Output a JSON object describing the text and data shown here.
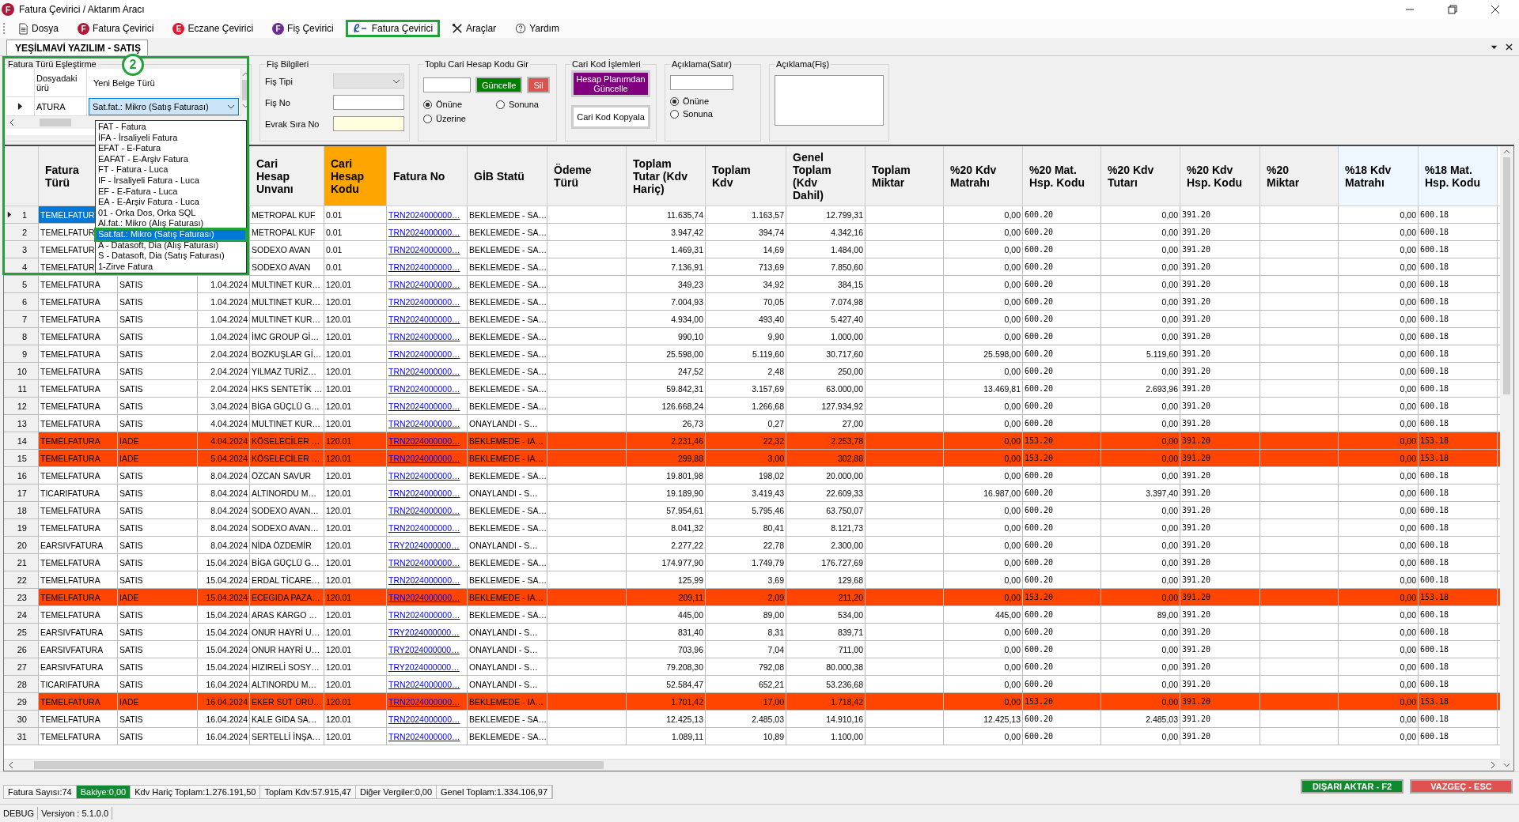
{
  "window": {
    "title": "Fatura Çevirici / Aktarım Aracı",
    "badge": "F",
    "color": "#b0193a"
  },
  "menu": [
    {
      "label": "Dosya",
      "outlined": false
    },
    {
      "label": "Fatura Çevirici",
      "outlined": false,
      "badge": "F",
      "color": "#b0193a"
    },
    {
      "label": "Eczane Çevirici",
      "outlined": false,
      "badge": "E",
      "color": "#e3182d"
    },
    {
      "label": "Fiş Çevirici",
      "outlined": false,
      "badge": "F",
      "color": "#6a2c91"
    },
    {
      "label": "Fatura Çevirici",
      "outlined": true
    },
    {
      "label": "Araçlar",
      "outlined": false
    },
    {
      "label": "Yardım",
      "outlined": false
    }
  ],
  "tabs": [
    {
      "label": "YEŞİLMAVİ YAZILIM - SATIŞ",
      "selected": true
    }
  ],
  "mapping": {
    "title": "Fatura Türü Eşleştirme",
    "callout": "2",
    "columns": [
      "Dosyadaki ürü",
      "Yeni Belge Türü"
    ],
    "row": {
      "source": "ATURA",
      "value": "Sat.fat.: Mikro (Satış Faturası)"
    },
    "options": [
      {
        "label": "FAT - Fatura",
        "selected": false
      },
      {
        "label": "İFA - İrsaliyeli Fatura",
        "selected": false
      },
      {
        "label": "EFAT - E-Fatura",
        "selected": false
      },
      {
        "label": "EAFAT - E-Arşiv Fatura",
        "selected": false
      },
      {
        "label": "FT - Fatura - Luca",
        "selected": false
      },
      {
        "label": "IF - İrsaliyeli Fatura - Luca",
        "selected": false
      },
      {
        "label": "EF - E-Fatura - Luca",
        "selected": false
      },
      {
        "label": "EA - E-Arşiv Fatura - Luca",
        "selected": false
      },
      {
        "label": "01 - Orka Dos, Orka SQL",
        "selected": false
      },
      {
        "label": "Al.fat.: Mikro (Alış Faturası)",
        "selected": false
      },
      {
        "label": "Sat.fat.: Mikro (Satış Faturası)",
        "selected": true
      },
      {
        "label": "A - Datasoft, Dia (Alış Faturası)",
        "selected": false
      },
      {
        "label": "S - Datasoft, Dia (Satış Faturası)",
        "selected": false
      },
      {
        "label": "1-Zirve Fatura",
        "selected": false
      }
    ]
  },
  "fis": {
    "title": "Fiş Bilgileri",
    "fields": [
      {
        "label": "Fiş Tipi",
        "kind": "combo",
        "disabled": true
      },
      {
        "label": "Fiş No",
        "kind": "input",
        "disabled": false
      },
      {
        "label": "Evrak Sıra No",
        "kind": "required",
        "disabled": false
      }
    ]
  },
  "toplu": {
    "title": "Toplu Cari Hesap Kodu Gir",
    "buttons": [
      {
        "label": "Güncelle",
        "color": "#008000"
      },
      {
        "label": "Sil",
        "color": "#d9534f"
      }
    ],
    "radios": [
      {
        "label": "Önüne",
        "selected": true
      },
      {
        "label": "Sonuna",
        "selected": false
      },
      {
        "label": "Üzerine",
        "selected": false
      }
    ]
  },
  "cari": {
    "title": "Cari Kod İşlemleri",
    "buttons": [
      {
        "label": "Hesap Planımdan Güncelle",
        "color": "#800080"
      },
      {
        "label": "Cari Kod Kopyala",
        "color": "#ffffff"
      }
    ]
  },
  "aciklama_satir": {
    "title": "Açıklama(Satır)",
    "radios": [
      {
        "label": "Önüne",
        "selected": true
      },
      {
        "label": "Sonuna",
        "selected": false
      }
    ]
  },
  "aciklama_fis": {
    "title": "Açıklama(Fiş)"
  },
  "table": {
    "columns": [
      {
        "label": "Fatura Türü",
        "kind": "text",
        "color": "#f0f0f0"
      },
      {
        "kind": "text"
      },
      {
        "kind": "number"
      },
      {
        "label": "Cari Hesap Unvanı",
        "kind": "text",
        "color": "#f0f0f0"
      },
      {
        "label": "Cari Hesap Kodu",
        "kind": "text",
        "color": "#ffa500"
      },
      {
        "label": "Fatura No",
        "kind": "link",
        "color": "#f0f0f0"
      },
      {
        "label": "GİB Statü",
        "kind": "text",
        "color": "#f0f0f0"
      },
      {
        "label": "Ödeme Türü",
        "color": "#f0f0f0"
      },
      {
        "label": "Toplam Tutar (Kdv Hariç)",
        "kind": "number",
        "color": "#f0f0f0"
      },
      {
        "label": "Toplam Kdv",
        "kind": "number",
        "color": "#f0f0f0"
      },
      {
        "label": "Genel Toplam (Kdv Dahil)",
        "kind": "number",
        "color": "#f0f0f0"
      },
      {
        "label": "Toplam Miktar",
        "color": "#f0f0f0"
      },
      {
        "label": "%20 Kdv Matrahı",
        "kind": "number",
        "color": "#f0f0f0"
      },
      {
        "label": "%20 Mat. Hsp. Kodu",
        "kind": "code",
        "color": "#f0f0f0"
      },
      {
        "label": "%20 Kdv Tutarı",
        "kind": "number",
        "color": "#f0f0f0"
      },
      {
        "label": "%20 Kdv Hsp. Kodu",
        "kind": "code",
        "color": "#f0f0f0"
      },
      {
        "label": "%20 Miktar",
        "color": "#f0f0f0"
      },
      {
        "label": "%18 Kdv Matrahı",
        "kind": "number",
        "color": "#eef6ff"
      },
      {
        "label": "%18 Mat. Hsp. Kodu",
        "kind": "code",
        "color": "#eef6ff"
      }
    ],
    "rows": [
      {
        "no": "1",
        "selected": true,
        "highlighted": false,
        "cells": [
          "TEMELFATUR",
          null,
          null,
          "METROPAL KUF",
          "0.01",
          "TRN2024000000…",
          "BEKLEMEDE - SA…",
          null,
          "11.635,74",
          "1.163,57",
          "12.799,31",
          null,
          "0,00",
          "600.20",
          "0,00",
          "391.20",
          null,
          "0,00",
          "600.18"
        ]
      },
      {
        "no": "2",
        "selected": false,
        "highlighted": false,
        "cells": [
          "TEMELFATUR",
          null,
          null,
          "METROPAL KUF",
          "0.01",
          "TRN2024000000…",
          "BEKLEMEDE - SA…",
          null,
          "3.947,42",
          "394,74",
          "4.342,16",
          null,
          "0,00",
          "600.20",
          "0,00",
          "391.20",
          null,
          "0,00",
          "600.18"
        ]
      },
      {
        "no": "3",
        "selected": false,
        "highlighted": false,
        "cells": [
          "TEMELFATUR",
          null,
          null,
          "SODEXO AVAN",
          "0.01",
          "TRN2024000000…",
          "BEKLEMEDE - SA…",
          null,
          "1.469,31",
          "14,69",
          "1.484,00",
          null,
          "0,00",
          "600.20",
          "0,00",
          "391.20",
          null,
          "0,00",
          "600.18"
        ]
      },
      {
        "no": "4",
        "selected": false,
        "highlighted": false,
        "cells": [
          "TEMELFATUR",
          null,
          null,
          "SODEXO AVAN",
          "0.01",
          "TRN2024000000…",
          "BEKLEMEDE - SA…",
          null,
          "7.136,91",
          "713,69",
          "7.850,60",
          null,
          "0,00",
          "600.20",
          "0,00",
          "391.20",
          null,
          "0,00",
          "600.18"
        ]
      },
      {
        "no": "5",
        "selected": false,
        "highlighted": false,
        "cells": [
          "TEMELFATURA",
          "SATIS",
          "1.04.2024",
          "MULTINET KUR…",
          "120.01",
          "TRN2024000000…",
          "BEKLEMEDE - SA…",
          null,
          "349,23",
          "34,92",
          "384,15",
          null,
          "0,00",
          "600.20",
          "0,00",
          "391.20",
          null,
          "0,00",
          "600.18"
        ]
      },
      {
        "no": "6",
        "selected": false,
        "highlighted": false,
        "cells": [
          "TEMELFATURA",
          "SATIS",
          "1.04.2024",
          "MULTINET KUR…",
          "120.01",
          "TRN2024000000…",
          "BEKLEMEDE - SA…",
          null,
          "7.004,93",
          "70,05",
          "7.074,98",
          null,
          "0,00",
          "600.20",
          "0,00",
          "391.20",
          null,
          "0,00",
          "600.18"
        ]
      },
      {
        "no": "7",
        "selected": false,
        "highlighted": false,
        "cells": [
          "TEMELFATURA",
          "SATIS",
          "1.04.2024",
          "MULTINET KUR…",
          "120.01",
          "TRN2024000000…",
          "BEKLEMEDE - SA…",
          null,
          "4.934,00",
          "493,40",
          "5.427,40",
          null,
          "0,00",
          "600.20",
          "0,00",
          "391.20",
          null,
          "0,00",
          "600.18"
        ]
      },
      {
        "no": "8",
        "selected": false,
        "highlighted": false,
        "cells": [
          "TEMELFATURA",
          "SATIS",
          "1.04.2024",
          "İMC GROUP Gİ…",
          "120.01",
          "TRN2024000000…",
          "BEKLEMEDE - SA…",
          null,
          "990,10",
          "9,90",
          "1.000,00",
          null,
          "0,00",
          "600.20",
          "0,00",
          "391.20",
          null,
          "0,00",
          "600.18"
        ]
      },
      {
        "no": "9",
        "selected": false,
        "highlighted": false,
        "cells": [
          "TEMELFATURA",
          "SATIS",
          "2.04.2024",
          "BOZKUŞLAR Gİ…",
          "120.01",
          "TRN2024000000…",
          "BEKLEMEDE - SA…",
          null,
          "25.598,00",
          "5.119,60",
          "30.717,60",
          null,
          "25.598,00",
          "600.20",
          "5.119,60",
          "391.20",
          null,
          "0,00",
          "600.18"
        ]
      },
      {
        "no": "10",
        "selected": false,
        "highlighted": false,
        "cells": [
          "TEMELFATURA",
          "SATIS",
          "2.04.2024",
          "YILMAZ TURİZ…",
          "120.01",
          "TRN2024000000…",
          "BEKLEMEDE - SA…",
          null,
          "247,52",
          "2,48",
          "250,00",
          null,
          "0,00",
          "600.20",
          "0,00",
          "391.20",
          null,
          "0,00",
          "600.18"
        ]
      },
      {
        "no": "11",
        "selected": false,
        "highlighted": false,
        "cells": [
          "TEMELFATURA",
          "SATIS",
          "2.04.2024",
          "HKS SENTETİK …",
          "120.01",
          "TRN2024000000…",
          "BEKLEMEDE - SA…",
          null,
          "59.842,31",
          "3.157,69",
          "63.000,00",
          null,
          "13.469,81",
          "600.20",
          "2.693,96",
          "391.20",
          null,
          "0,00",
          "600.18"
        ]
      },
      {
        "no": "12",
        "selected": false,
        "highlighted": false,
        "cells": [
          "TEMELFATURA",
          "SATIS",
          "3.04.2024",
          "BİGA GÜÇLÜ G…",
          "120.01",
          "TRN2024000000…",
          "BEKLEMEDE - SA…",
          null,
          "126.668,24",
          "1.266,68",
          "127.934,92",
          null,
          "0,00",
          "600.20",
          "0,00",
          "391.20",
          null,
          "0,00",
          "600.18"
        ]
      },
      {
        "no": "13",
        "selected": false,
        "highlighted": false,
        "cells": [
          "TEMELFATURA",
          "SATIS",
          "4.04.2024",
          "MULTINET KUR…",
          "120.01",
          "TRN2024000000…",
          "ONAYLANDI - S…",
          null,
          "26,73",
          "0,27",
          "27,00",
          null,
          "0,00",
          "600.20",
          "0,00",
          "391.20",
          null,
          "0,00",
          "600.18"
        ]
      },
      {
        "no": "14",
        "selected": false,
        "highlighted": true,
        "cells": [
          "TEMELFATURA",
          "IADE",
          "4.04.2024",
          "KÖSELECİLER …",
          "120.01",
          "TRN2024000000…",
          "BEKLEMEDE - IA…",
          null,
          "2.231,46",
          "22,32",
          "2.253,78",
          null,
          "0,00",
          "153.20",
          "0,00",
          "391.20",
          null,
          "0,00",
          "153.18"
        ]
      },
      {
        "no": "15",
        "selected": false,
        "highlighted": true,
        "cells": [
          "TEMELFATURA",
          "IADE",
          "5.04.2024",
          "KÖSELECİLER …",
          "120.01",
          "TRN2024000000…",
          "BEKLEMEDE - IA…",
          null,
          "299,88",
          "3,00",
          "302,88",
          null,
          "0,00",
          "153.20",
          "0,00",
          "391.20",
          null,
          "0,00",
          "153.18"
        ]
      },
      {
        "no": "16",
        "selected": false,
        "highlighted": false,
        "cells": [
          "TEMELFATURA",
          "SATIS",
          "8.04.2024",
          "ÖZCAN SAVUR",
          "120.01",
          "TRN2024000000…",
          "BEKLEMEDE - SA…",
          null,
          "19.801,98",
          "198,02",
          "20.000,00",
          null,
          "0,00",
          "600.20",
          "0,00",
          "391.20",
          null,
          "0,00",
          "600.18"
        ]
      },
      {
        "no": "17",
        "selected": false,
        "highlighted": false,
        "cells": [
          "TICARIFATURA",
          "SATIS",
          "8.04.2024",
          "ALTINORDU M…",
          "120.01",
          "TRN2024000000…",
          "ONAYLANDI - S…",
          null,
          "19.189,90",
          "3.419,43",
          "22.609,33",
          null,
          "16.987,00",
          "600.20",
          "3.397,40",
          "391.20",
          null,
          "0,00",
          "600.18"
        ]
      },
      {
        "no": "18",
        "selected": false,
        "highlighted": false,
        "cells": [
          "TEMELFATURA",
          "SATIS",
          "8.04.2024",
          "SODEXO AVAN…",
          "120.01",
          "TRN2024000000…",
          "BEKLEMEDE - SA…",
          null,
          "57.954,61",
          "5.795,46",
          "63.750,07",
          null,
          "0,00",
          "600.20",
          "0,00",
          "391.20",
          null,
          "0,00",
          "600.18"
        ]
      },
      {
        "no": "19",
        "selected": false,
        "highlighted": false,
        "cells": [
          "TEMELFATURA",
          "SATIS",
          "8.04.2024",
          "SODEXO AVAN…",
          "120.01",
          "TRN2024000000…",
          "BEKLEMEDE - SA…",
          null,
          "8.041,32",
          "80,41",
          "8.121,73",
          null,
          "0,00",
          "600.20",
          "0,00",
          "391.20",
          null,
          "0,00",
          "600.18"
        ]
      },
      {
        "no": "20",
        "selected": false,
        "highlighted": false,
        "cells": [
          "EARSIVFATURA",
          "SATIS",
          "8.04.2024",
          "NİDA ÖZDEMİR",
          "120.01",
          "TRY2024000000…",
          "ONAYLANDI - S…",
          null,
          "2.277,22",
          "22,78",
          "2.300,00",
          null,
          "0,00",
          "600.20",
          "0,00",
          "391.20",
          null,
          "0,00",
          "600.18"
        ]
      },
      {
        "no": "21",
        "selected": false,
        "highlighted": false,
        "cells": [
          "TEMELFATURA",
          "SATIS",
          "15.04.2024",
          "BİGA GÜÇLÜ G…",
          "120.01",
          "TRN2024000000…",
          "BEKLEMEDE - SA…",
          null,
          "174.977,90",
          "1.749,79",
          "176.727,69",
          null,
          "0,00",
          "600.20",
          "0,00",
          "391.20",
          null,
          "0,00",
          "600.18"
        ]
      },
      {
        "no": "22",
        "selected": false,
        "highlighted": false,
        "cells": [
          "TEMELFATURA",
          "SATIS",
          "15.04.2024",
          "ERDAL TİCARE…",
          "120.01",
          "TRN2024000000…",
          "BEKLEMEDE - SA…",
          null,
          "125,99",
          "3,69",
          "129,68",
          null,
          "0,00",
          "600.20",
          "0,00",
          "391.20",
          null,
          "0,00",
          "600.18"
        ]
      },
      {
        "no": "23",
        "selected": false,
        "highlighted": true,
        "cells": [
          "TEMELFATURA",
          "IADE",
          "15.04.2024",
          "ECEGIDA PAZA…",
          "120.01",
          "TRN2024000000…",
          "BEKLEMEDE - IA…",
          null,
          "209,11",
          "2,09",
          "211,20",
          null,
          "0,00",
          "153.20",
          "0,00",
          "391.20",
          null,
          "0,00",
          "153.18"
        ]
      },
      {
        "no": "24",
        "selected": false,
        "highlighted": false,
        "cells": [
          "TEMELFATURA",
          "SATIS",
          "15.04.2024",
          "ARAS KARGO …",
          "120.01",
          "TRN2024000000…",
          "BEKLEMEDE - SA…",
          null,
          "445,00",
          "89,00",
          "534,00",
          null,
          "445,00",
          "600.20",
          "89,00",
          "391.20",
          null,
          "0,00",
          "600.18"
        ]
      },
      {
        "no": "25",
        "selected": false,
        "highlighted": false,
        "cells": [
          "EARSIVFATURA",
          "SATIS",
          "15.04.2024",
          "ONUR HAYRİ U…",
          "120.01",
          "TRY2024000000…",
          "ONAYLANDI - S…",
          null,
          "831,40",
          "8,31",
          "839,71",
          null,
          "0,00",
          "600.20",
          "0,00",
          "391.20",
          null,
          "0,00",
          "600.18"
        ]
      },
      {
        "no": "26",
        "selected": false,
        "highlighted": false,
        "cells": [
          "EARSIVFATURA",
          "SATIS",
          "15.04.2024",
          "ONUR HAYRİ U…",
          "120.01",
          "TRY2024000000…",
          "ONAYLANDI - S…",
          null,
          "703,96",
          "7,04",
          "711,00",
          null,
          "0,00",
          "600.20",
          "0,00",
          "391.20",
          null,
          "0,00",
          "600.18"
        ]
      },
      {
        "no": "27",
        "selected": false,
        "highlighted": false,
        "cells": [
          "EARSIVFATURA",
          "SATIS",
          "15.04.2024",
          "HIZIRELİ SOSY…",
          "120.01",
          "TRY2024000000…",
          "ONAYLANDI - S…",
          null,
          "79.208,30",
          "792,08",
          "80.000,38",
          null,
          "0,00",
          "600.20",
          "0,00",
          "391.20",
          null,
          "0,00",
          "600.18"
        ]
      },
      {
        "no": "28",
        "selected": false,
        "highlighted": false,
        "cells": [
          "TICARIFATURA",
          "SATIS",
          "16.04.2024",
          "ALTINORDU M…",
          "120.01",
          "TRN2024000000…",
          "ONAYLANDI - S…",
          null,
          "52.584,47",
          "652,21",
          "53.236,68",
          null,
          "0,00",
          "600.20",
          "0,00",
          "391.20",
          null,
          "0,00",
          "600.18"
        ]
      },
      {
        "no": "29",
        "selected": false,
        "highlighted": true,
        "cells": [
          "TEMELFATURA",
          "IADE",
          "16.04.2024",
          "EKER SÜT ÜRÜ…",
          "120.01",
          "TRN2024000000…",
          "BEKLEMEDE - IA…",
          null,
          "1.701,42",
          "17,00",
          "1.718,42",
          null,
          "0,00",
          "153.20",
          "0,00",
          "391.20",
          null,
          "0,00",
          "153.18"
        ]
      },
      {
        "no": "30",
        "selected": false,
        "highlighted": false,
        "cells": [
          "TEMELFATURA",
          "SATIS",
          "16.04.2024",
          "KALE GIDA SA…",
          "120.01",
          "TRN2024000000…",
          "BEKLEMEDE - SA…",
          null,
          "12.425,13",
          "2.485,03",
          "14.910,16",
          null,
          "12.425,13",
          "600.20",
          "2.485,03",
          "391.20",
          null,
          "0,00",
          "600.18"
        ]
      },
      {
        "no": "31",
        "selected": false,
        "highlighted": false,
        "cells": [
          "TEMELFATURA",
          "SATIS",
          "16.04.2024",
          "SERTELLİ İNŞA…",
          "120.01",
          "TRN2024000000…",
          "BEKLEMEDE - SA…",
          null,
          "1.089,11",
          "10,89",
          "1.100,00",
          null,
          "0,00",
          "600.20",
          "0,00",
          "391.20",
          null,
          "0,00",
          "600.18"
        ]
      }
    ]
  },
  "status_bar": {
    "items": [
      {
        "label": "Fatura Sayısı:74",
        "highlighted": false
      },
      {
        "label": "Bakiye:0,00",
        "highlighted": true
      },
      {
        "label": "Kdv Hariç Toplam:1.276.191,50",
        "highlighted": false
      },
      {
        "label": "Toplam Kdv:57.915,47",
        "highlighted": false
      },
      {
        "label": "Diğer Vergiler:0,00",
        "highlighted": false
      },
      {
        "label": "Genel Toplam:1.334.106,97",
        "highlighted": false
      }
    ],
    "buttons": [
      {
        "label": "DIŞARI AKTAR - F2",
        "color": "#0f8a2e"
      },
      {
        "label": "VAZGEÇ - ESC",
        "color": "#e05252"
      }
    ]
  },
  "footer": [
    "DEBUG",
    "Versiyon : 5.1.0.0"
  ]
}
